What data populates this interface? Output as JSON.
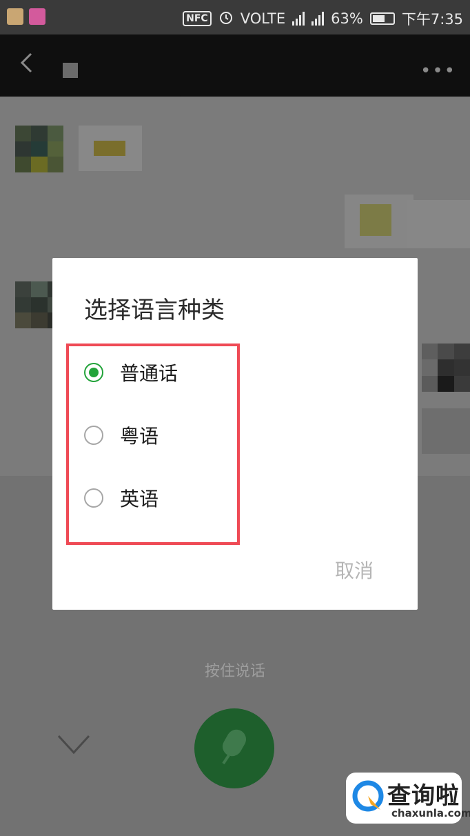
{
  "status_bar": {
    "nfc": "NFC",
    "volte": "VOLTE",
    "net1": "G",
    "net2": "4G",
    "battery": "63%",
    "time": "下午7:35",
    "battery_level": 0.63
  },
  "colors": {
    "accent": "#22a33a",
    "highlight": "#ef4a55",
    "mic_button": "#1e5f2c"
  },
  "dialog": {
    "title": "选择语言种类",
    "options": [
      {
        "label": "普通话",
        "selected": true
      },
      {
        "label": "粤语",
        "selected": false
      },
      {
        "label": "英语",
        "selected": false
      }
    ],
    "cancel": "取消"
  },
  "voice_input": {
    "hint": "按住说话"
  },
  "watermark": {
    "brand_cn": "查询啦",
    "brand_en": "chaxunla.com"
  }
}
